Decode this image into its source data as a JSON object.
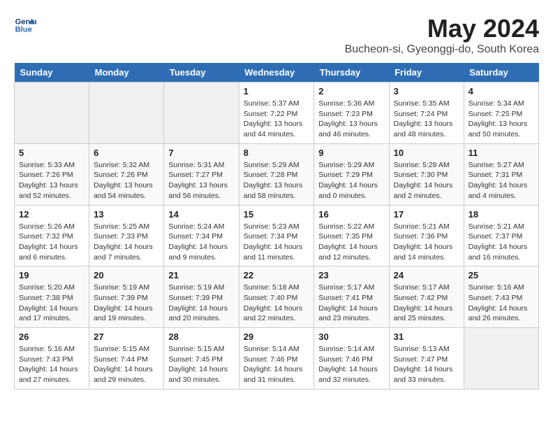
{
  "header": {
    "logo_line1": "General",
    "logo_line2": "Blue",
    "title": "May 2024",
    "subtitle": "Bucheon-si, Gyeonggi-do, South Korea"
  },
  "weekdays": [
    "Sunday",
    "Monday",
    "Tuesday",
    "Wednesday",
    "Thursday",
    "Friday",
    "Saturday"
  ],
  "weeks": [
    [
      {
        "day": "",
        "sunrise": "",
        "sunset": "",
        "daylight": ""
      },
      {
        "day": "",
        "sunrise": "",
        "sunset": "",
        "daylight": ""
      },
      {
        "day": "",
        "sunrise": "",
        "sunset": "",
        "daylight": ""
      },
      {
        "day": "1",
        "sunrise": "Sunrise: 5:37 AM",
        "sunset": "Sunset: 7:22 PM",
        "daylight": "Daylight: 13 hours and 44 minutes."
      },
      {
        "day": "2",
        "sunrise": "Sunrise: 5:36 AM",
        "sunset": "Sunset: 7:23 PM",
        "daylight": "Daylight: 13 hours and 46 minutes."
      },
      {
        "day": "3",
        "sunrise": "Sunrise: 5:35 AM",
        "sunset": "Sunset: 7:24 PM",
        "daylight": "Daylight: 13 hours and 48 minutes."
      },
      {
        "day": "4",
        "sunrise": "Sunrise: 5:34 AM",
        "sunset": "Sunset: 7:25 PM",
        "daylight": "Daylight: 13 hours and 50 minutes."
      }
    ],
    [
      {
        "day": "5",
        "sunrise": "Sunrise: 5:33 AM",
        "sunset": "Sunset: 7:26 PM",
        "daylight": "Daylight: 13 hours and 52 minutes."
      },
      {
        "day": "6",
        "sunrise": "Sunrise: 5:32 AM",
        "sunset": "Sunset: 7:26 PM",
        "daylight": "Daylight: 13 hours and 54 minutes."
      },
      {
        "day": "7",
        "sunrise": "Sunrise: 5:31 AM",
        "sunset": "Sunset: 7:27 PM",
        "daylight": "Daylight: 13 hours and 56 minutes."
      },
      {
        "day": "8",
        "sunrise": "Sunrise: 5:29 AM",
        "sunset": "Sunset: 7:28 PM",
        "daylight": "Daylight: 13 hours and 58 minutes."
      },
      {
        "day": "9",
        "sunrise": "Sunrise: 5:29 AM",
        "sunset": "Sunset: 7:29 PM",
        "daylight": "Daylight: 14 hours and 0 minutes."
      },
      {
        "day": "10",
        "sunrise": "Sunrise: 5:28 AM",
        "sunset": "Sunset: 7:30 PM",
        "daylight": "Daylight: 14 hours and 2 minutes."
      },
      {
        "day": "11",
        "sunrise": "Sunrise: 5:27 AM",
        "sunset": "Sunset: 7:31 PM",
        "daylight": "Daylight: 14 hours and 4 minutes."
      }
    ],
    [
      {
        "day": "12",
        "sunrise": "Sunrise: 5:26 AM",
        "sunset": "Sunset: 7:32 PM",
        "daylight": "Daylight: 14 hours and 6 minutes."
      },
      {
        "day": "13",
        "sunrise": "Sunrise: 5:25 AM",
        "sunset": "Sunset: 7:33 PM",
        "daylight": "Daylight: 14 hours and 7 minutes."
      },
      {
        "day": "14",
        "sunrise": "Sunrise: 5:24 AM",
        "sunset": "Sunset: 7:34 PM",
        "daylight": "Daylight: 14 hours and 9 minutes."
      },
      {
        "day": "15",
        "sunrise": "Sunrise: 5:23 AM",
        "sunset": "Sunset: 7:34 PM",
        "daylight": "Daylight: 14 hours and 11 minutes."
      },
      {
        "day": "16",
        "sunrise": "Sunrise: 5:22 AM",
        "sunset": "Sunset: 7:35 PM",
        "daylight": "Daylight: 14 hours and 12 minutes."
      },
      {
        "day": "17",
        "sunrise": "Sunrise: 5:21 AM",
        "sunset": "Sunset: 7:36 PM",
        "daylight": "Daylight: 14 hours and 14 minutes."
      },
      {
        "day": "18",
        "sunrise": "Sunrise: 5:21 AM",
        "sunset": "Sunset: 7:37 PM",
        "daylight": "Daylight: 14 hours and 16 minutes."
      }
    ],
    [
      {
        "day": "19",
        "sunrise": "Sunrise: 5:20 AM",
        "sunset": "Sunset: 7:38 PM",
        "daylight": "Daylight: 14 hours and 17 minutes."
      },
      {
        "day": "20",
        "sunrise": "Sunrise: 5:19 AM",
        "sunset": "Sunset: 7:39 PM",
        "daylight": "Daylight: 14 hours and 19 minutes."
      },
      {
        "day": "21",
        "sunrise": "Sunrise: 5:19 AM",
        "sunset": "Sunset: 7:39 PM",
        "daylight": "Daylight: 14 hours and 20 minutes."
      },
      {
        "day": "22",
        "sunrise": "Sunrise: 5:18 AM",
        "sunset": "Sunset: 7:40 PM",
        "daylight": "Daylight: 14 hours and 22 minutes."
      },
      {
        "day": "23",
        "sunrise": "Sunrise: 5:17 AM",
        "sunset": "Sunset: 7:41 PM",
        "daylight": "Daylight: 14 hours and 23 minutes."
      },
      {
        "day": "24",
        "sunrise": "Sunrise: 5:17 AM",
        "sunset": "Sunset: 7:42 PM",
        "daylight": "Daylight: 14 hours and 25 minutes."
      },
      {
        "day": "25",
        "sunrise": "Sunrise: 5:16 AM",
        "sunset": "Sunset: 7:43 PM",
        "daylight": "Daylight: 14 hours and 26 minutes."
      }
    ],
    [
      {
        "day": "26",
        "sunrise": "Sunrise: 5:16 AM",
        "sunset": "Sunset: 7:43 PM",
        "daylight": "Daylight: 14 hours and 27 minutes."
      },
      {
        "day": "27",
        "sunrise": "Sunrise: 5:15 AM",
        "sunset": "Sunset: 7:44 PM",
        "daylight": "Daylight: 14 hours and 29 minutes."
      },
      {
        "day": "28",
        "sunrise": "Sunrise: 5:15 AM",
        "sunset": "Sunset: 7:45 PM",
        "daylight": "Daylight: 14 hours and 30 minutes."
      },
      {
        "day": "29",
        "sunrise": "Sunrise: 5:14 AM",
        "sunset": "Sunset: 7:46 PM",
        "daylight": "Daylight: 14 hours and 31 minutes."
      },
      {
        "day": "30",
        "sunrise": "Sunrise: 5:14 AM",
        "sunset": "Sunset: 7:46 PM",
        "daylight": "Daylight: 14 hours and 32 minutes."
      },
      {
        "day": "31",
        "sunrise": "Sunrise: 5:13 AM",
        "sunset": "Sunset: 7:47 PM",
        "daylight": "Daylight: 14 hours and 33 minutes."
      },
      {
        "day": "",
        "sunrise": "",
        "sunset": "",
        "daylight": ""
      }
    ]
  ]
}
